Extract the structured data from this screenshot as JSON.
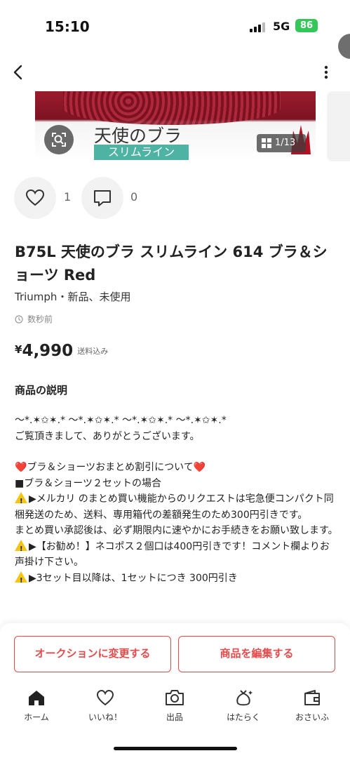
{
  "status_bar": {
    "time": "15:10",
    "network": "5G",
    "battery": "86"
  },
  "gallery": {
    "photo_title": "天使のブラ",
    "photo_subtitle": "スリムライン",
    "counter": "1/13"
  },
  "social": {
    "likes": "1",
    "comments": "0"
  },
  "product": {
    "title": "B75L 天使のブラ スリムライン 614 ブラ＆ショーツ Red",
    "brand_condition": "Triumph・新品、未使用",
    "posted": "数秒前",
    "currency": "¥",
    "price": "4,990",
    "shipping": "送料込み"
  },
  "description": {
    "heading": "商品の説明",
    "line1": "〜*.✶✩✶.* 〜*.✶✩✶.* 〜*.✶✩✶.* 〜*.✶✩✶.*",
    "line2": "ご覧頂きまして、ありがとうございます。",
    "line3_heart": "❤️",
    "line3": "ブラ＆ショーツおまとめ割引について",
    "line4": "■ブラ＆ショーツ２セットの場合",
    "line5": "▶メルカリ のまとめ買い機能からのリクエストは宅急便コンパクト同梱発送のため、送料、専用箱代の差額発生のため300円引きです。",
    "line6": "まとめ買い承認後は、必ず期限内に速やかにお手続きをお願い致します。",
    "line7": "▶【お勧め！】ネコポス２個口は400円引きです！コメント欄よりお声掛け下さい。",
    "line8": "▶3セット目以降は、1セットにつき 300円引き"
  },
  "actions": {
    "auction": "オークションに変更する",
    "edit": "商品を編集する"
  },
  "tabs": [
    {
      "label": "ホーム",
      "icon": "home-icon"
    },
    {
      "label": "いいね！",
      "icon": "heart-icon"
    },
    {
      "label": "出品",
      "icon": "camera-icon"
    },
    {
      "label": "はたらく",
      "icon": "money-bag-icon"
    },
    {
      "label": "おさいふ",
      "icon": "wallet-icon"
    }
  ],
  "colors": {
    "accent": "#e54b4b",
    "battery": "#35c759",
    "banner": "#4eb3a3"
  }
}
